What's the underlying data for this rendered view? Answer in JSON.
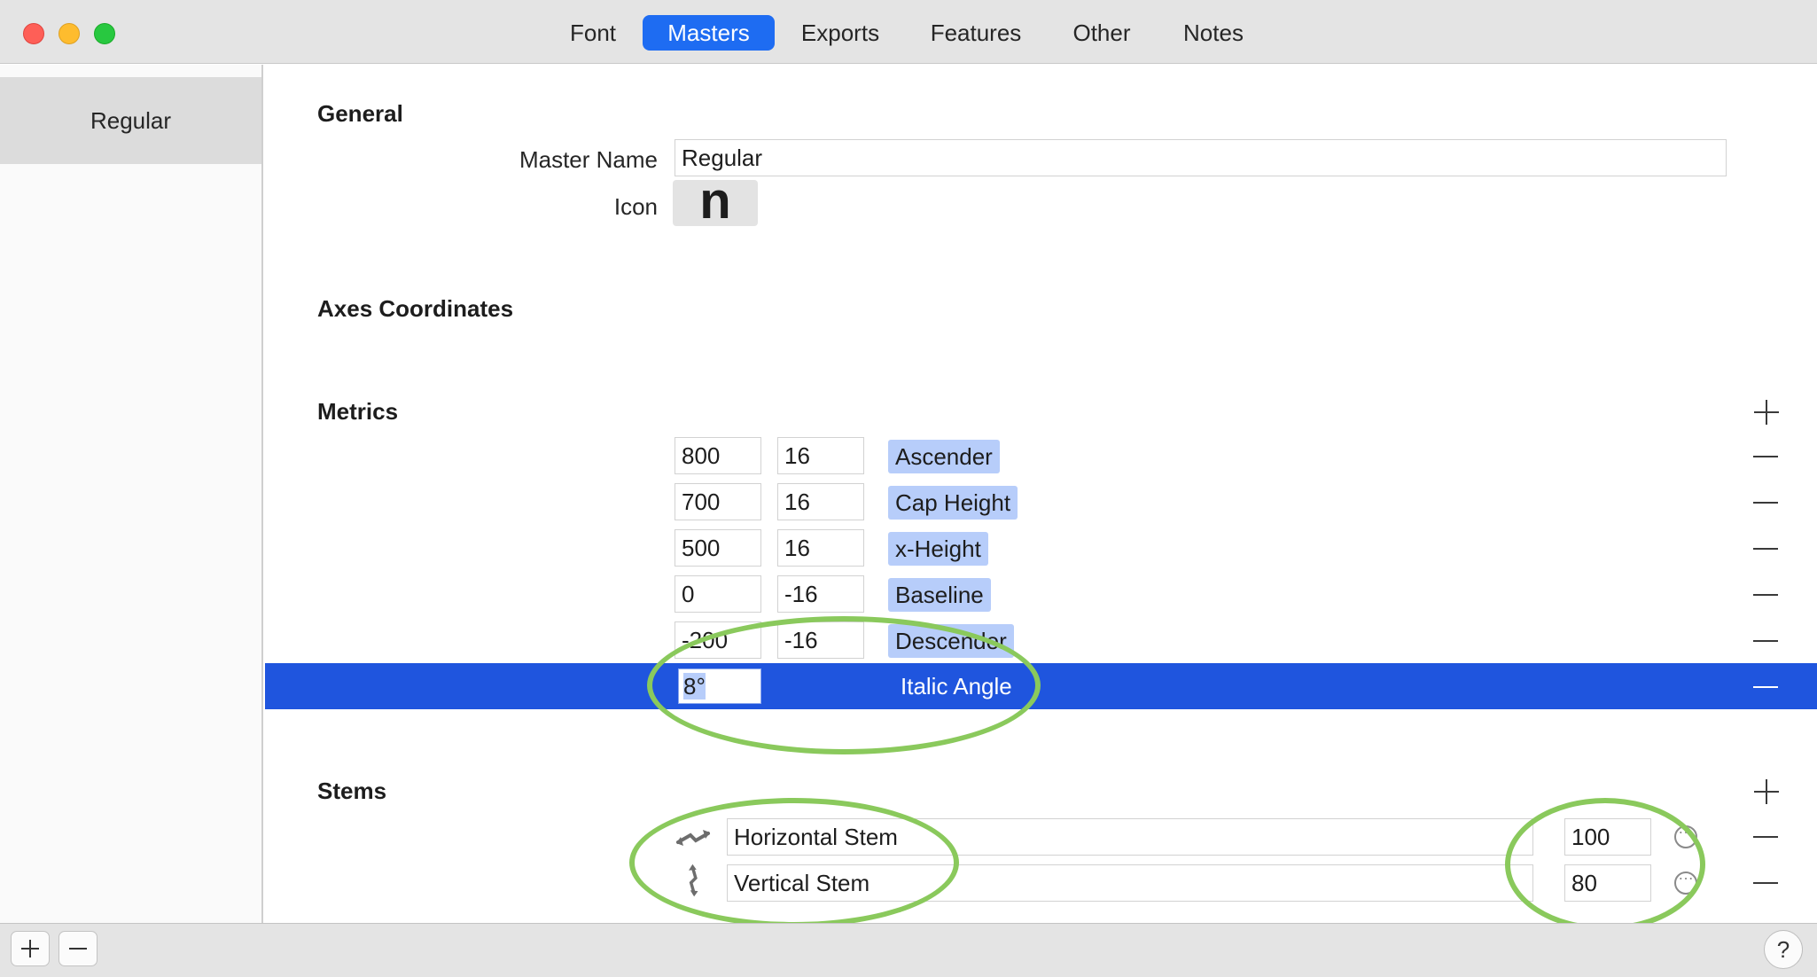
{
  "window": {
    "tabs": [
      {
        "label": "Font",
        "active": false
      },
      {
        "label": "Masters",
        "active": true
      },
      {
        "label": "Exports",
        "active": false
      },
      {
        "label": "Features",
        "active": false
      },
      {
        "label": "Other",
        "active": false
      },
      {
        "label": "Notes",
        "active": false
      }
    ]
  },
  "sidebar": {
    "items": [
      {
        "label": "Regular",
        "selected": true
      }
    ]
  },
  "general": {
    "title": "General",
    "master_name_label": "Master Name",
    "master_name_value": "Regular",
    "icon_label": "Icon",
    "icon_glyph": "n"
  },
  "axes": {
    "title": "Axes Coordinates"
  },
  "metrics": {
    "title": "Metrics",
    "rows": [
      {
        "position": "800",
        "overshoot": "16",
        "name": "Ascender"
      },
      {
        "position": "700",
        "overshoot": "16",
        "name": "Cap Height"
      },
      {
        "position": "500",
        "overshoot": "16",
        "name": "x-Height"
      },
      {
        "position": "0",
        "overshoot": "-16",
        "name": "Baseline"
      },
      {
        "position": "-200",
        "overshoot": "-16",
        "name": "Descender"
      }
    ],
    "italic_angle": {
      "value": "8°",
      "name": "Italic Angle",
      "selected": true
    }
  },
  "stems": {
    "title": "Stems",
    "rows": [
      {
        "name": "Horizontal Stem",
        "value": "100",
        "icon": "horizontal-stem-icon"
      },
      {
        "name": "Vertical Stem",
        "value": "80",
        "icon": "vertical-stem-icon"
      }
    ]
  },
  "bottom": {
    "add_label": "+",
    "remove_label": "−",
    "help_label": "?"
  },
  "colors": {
    "accent": "#1e6cf2",
    "selection": "#1f55de",
    "metric_tag": "#b7cdfa",
    "annotation": "#8ac95c"
  }
}
